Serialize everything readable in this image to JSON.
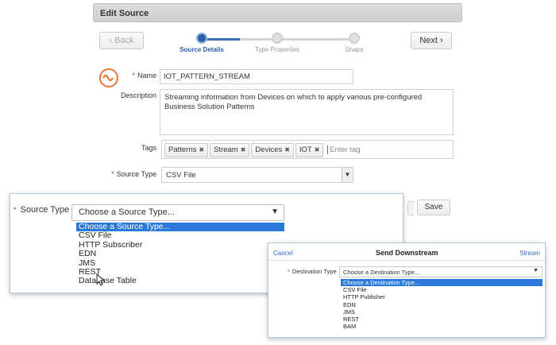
{
  "dialog": {
    "title": "Edit Source",
    "back_label": "‹ Back",
    "next_label": "Next ›",
    "steps": [
      {
        "label": "Source Details",
        "active": true
      },
      {
        "label": "Type Properties",
        "active": false
      },
      {
        "label": "Shape",
        "active": false
      }
    ],
    "name_label": "Name",
    "name_value": "IOT_PATTERN_STREAM",
    "description_label": "Description",
    "description_value": "Streaming information from Devices on which to apply various pre-configured Business Solution Patterns",
    "tags_label": "Tags",
    "tags": [
      "Patterns",
      "Stream",
      "Devices",
      "IOT"
    ],
    "tag_placeholder": "Enter tag",
    "source_type_label": "Source Type",
    "source_type_value": "CSV File",
    "save_label": "Save"
  },
  "source_type_popup": {
    "label": "Source Type",
    "selected": "Choose a Source Type...",
    "options": [
      "Choose a Source Type...",
      "CSV File",
      "HTTP Subscriber",
      "EDN",
      "JMS",
      "REST",
      "Database Table"
    ]
  },
  "send_downstream": {
    "cancel_label": "Cancel",
    "title": "Send Downstream",
    "stream_label": "Stream",
    "destination_label": "Destination Type",
    "selected": "Choose a Destination Type...",
    "options": [
      "Choose a Destination Type...",
      "CSV File",
      "HTTP Publisher",
      "EDN",
      "JMS",
      "REST",
      "BAM"
    ]
  },
  "colors": {
    "accent": "#2a5ea8",
    "selection": "#2b7ad9",
    "logo": "#e6763a"
  }
}
